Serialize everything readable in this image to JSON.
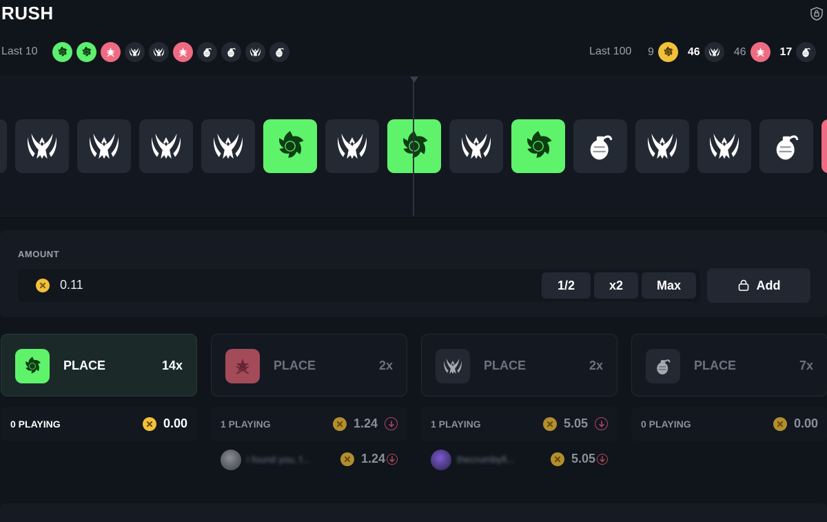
{
  "header": {
    "title": "RUSH",
    "last10_label": "Last 10",
    "last100_label": "Last 100",
    "last10": [
      "spiral",
      "spiral",
      "star",
      "wings",
      "wings",
      "star",
      "bomb",
      "bomb",
      "wings",
      "bomb"
    ],
    "last100": [
      {
        "count": "9",
        "icon": "spiral",
        "dim": true
      },
      {
        "count": "46",
        "icon": "wings",
        "dim": false
      },
      {
        "count": "46",
        "icon": "star",
        "dim": true
      },
      {
        "count": "17",
        "icon": "bomb",
        "dim": false
      }
    ]
  },
  "roulette": {
    "tiles": [
      "wings",
      "wings",
      "wings",
      "wings",
      "spiral",
      "wings",
      "spiral",
      "wings",
      "spiral",
      "bomb",
      "wings",
      "wings",
      "bomb"
    ]
  },
  "amount": {
    "label": "AMOUNT",
    "value": "0.11",
    "half_label": "1/2",
    "double_label": "x2",
    "max_label": "Max",
    "add_label": "Add"
  },
  "bets": [
    {
      "place_label": "PLACE",
      "multiplier": "14x",
      "icon": "spiral",
      "playing": "0 PLAYING",
      "total": "0.00",
      "players": []
    },
    {
      "place_label": "PLACE",
      "multiplier": "2x",
      "icon": "star",
      "playing": "1 PLAYING",
      "total": "1.24",
      "players": [
        {
          "name": "i found you, f...",
          "amount": "1.24"
        }
      ]
    },
    {
      "place_label": "PLACE",
      "multiplier": "2x",
      "icon": "wings",
      "playing": "1 PLAYING",
      "total": "5.05",
      "players": [
        {
          "name": "thecrumbyfi...",
          "amount": "5.05"
        }
      ]
    },
    {
      "place_label": "PLACE",
      "multiplier": "7x",
      "icon": "bomb",
      "playing": "0 PLAYING",
      "total": "0.00",
      "players": []
    }
  ],
  "colors": {
    "background": "#10141b",
    "green": "#5ff36c",
    "red": "#ef6b82",
    "gold": "#f2c13a",
    "tile_dark": "#242a34"
  }
}
